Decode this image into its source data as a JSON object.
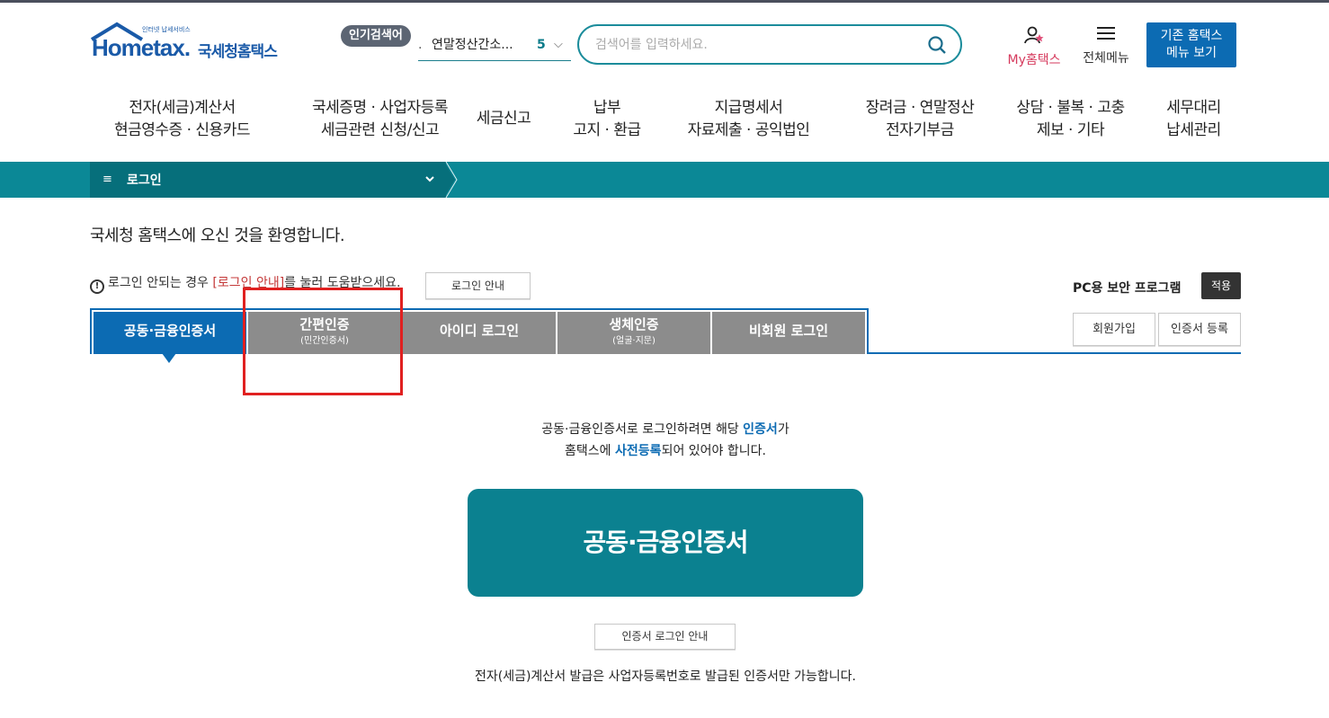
{
  "logo": {
    "small_text": "인터넷 납세서비스",
    "brand": "Hometax.",
    "korean": "국세청홈택스"
  },
  "popular": {
    "badge": "인기검색어",
    "prefix": ".",
    "term": "연말정산간소...",
    "rank": "5",
    "chevron": "⌵"
  },
  "search": {
    "placeholder": "검색어를 입력하세요."
  },
  "header": {
    "my_hometax": "My홈택스",
    "all_menu": "전체메뉴",
    "old_hometax_line1": "기존 홈택스",
    "old_hometax_line2": "메뉴 보기"
  },
  "gnb": [
    {
      "line1": "전자(세금)계산서",
      "line2": "현금영수증 · 신용카드"
    },
    {
      "line1": "국세증명 · 사업자등록",
      "line2": "세금관련 신청/신고"
    },
    {
      "line1": "세금신고",
      "line2": ""
    },
    {
      "line1": "납부",
      "line2": "고지 · 환급"
    },
    {
      "line1": "지급명세서",
      "line2": "자료제출 · 공익법인"
    },
    {
      "line1": "장려금 · 연말정산",
      "line2": "전자기부금"
    },
    {
      "line1": "상담 · 불복 · 고충",
      "line2": "제보 · 기타"
    },
    {
      "line1": "세무대리",
      "line2": "납세관리"
    }
  ],
  "breadcrumb": {
    "icon": "≡",
    "label": "로그인"
  },
  "welcome": "국세청 홈택스에 오신 것을 환영합니다.",
  "notice": {
    "before": "로그인 안되는 경우 ",
    "link": "[로그인 안내]",
    "after": "를 눌러 도움받으세요.",
    "button": "로그인 안내"
  },
  "security": {
    "label": "PC용 보안 프로그램",
    "apply": "적용"
  },
  "tabs": [
    {
      "label": "공동·금융인증서",
      "sub": ""
    },
    {
      "label": "간편인증",
      "sub": "(민간인증서)"
    },
    {
      "label": "아이디 로그인",
      "sub": ""
    },
    {
      "label": "생체인증",
      "sub": "(얼굴·지문)"
    },
    {
      "label": "비회원 로그인",
      "sub": ""
    }
  ],
  "side_buttons": {
    "join": "회원가입",
    "register_cert": "인증서 등록"
  },
  "description": {
    "l1_a": "공동·금융인증서로 로그인하려면 해당 ",
    "l1_b": "인증서",
    "l1_c": "가",
    "l2_a": "홈택스에 ",
    "l2_b": "사전등록",
    "l2_c": "되어 있어야 합니다."
  },
  "cert_button": "공동·금융인증서",
  "cert_guide_button": "인증서 로그인 안내",
  "footer_note": "전자(세금)계산서 발급은 사업자등록번호로 발급된 인증서만 가능합니다.",
  "colors": {
    "teal": "#0b8896",
    "blue": "#0c6bb3",
    "tab_gray": "#8c8c8c",
    "highlight": "#e02020",
    "pink": "#d63a5d"
  }
}
